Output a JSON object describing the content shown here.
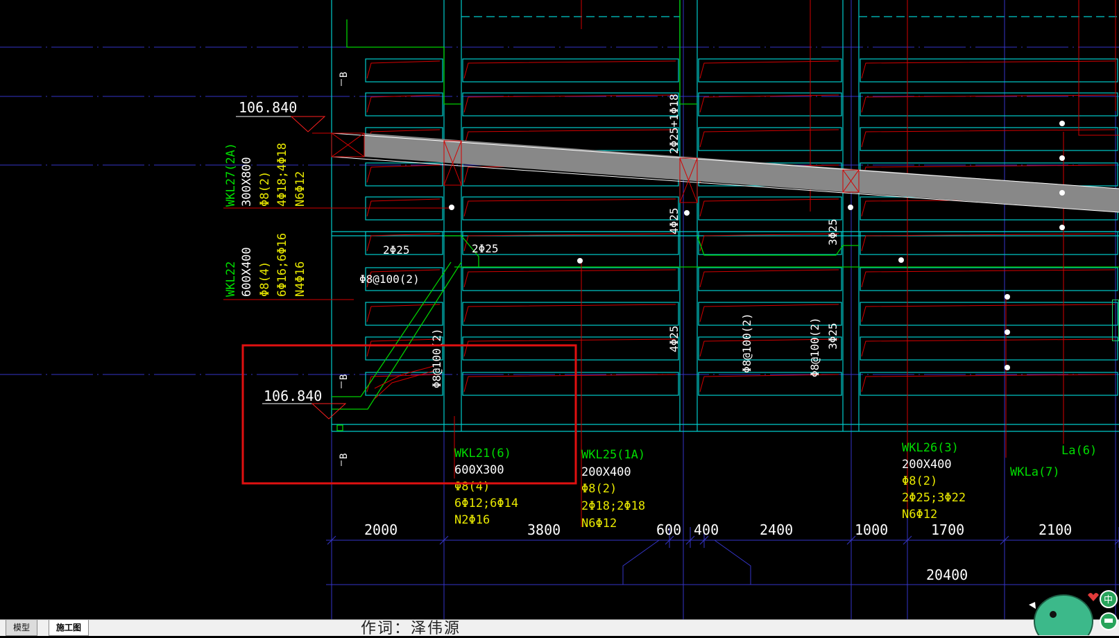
{
  "tabs": [
    {
      "label": "模型"
    },
    {
      "label": "施工图"
    }
  ],
  "author": "作词：泽伟源",
  "elevations": {
    "top": "106.840",
    "bottom": "106.840"
  },
  "section_marks": {
    "b1": "B",
    "b2": "B",
    "b3": "B"
  },
  "beam_labels": {
    "wkl27": {
      "name": "WKL27(2A)",
      "size": "300X800",
      "stirrup": "Φ8(2)",
      "rebar": "4Φ18;4Φ18",
      "waist": "N6Φ12"
    },
    "wkl22": {
      "name": "WKL22",
      "size": "600X400",
      "stirrup": "Φ8(4)",
      "rebar": "6Φ16;6Φ16",
      "waist": "N4Φ16"
    },
    "wkl21": {
      "name": "WKL21(6)",
      "size": "600X300",
      "stirrup": "Φ8(4)",
      "rebar": "6Φ12;6Φ14",
      "waist": "N2Φ16"
    },
    "wkl25": {
      "name": "WKL25(1A)",
      "size": "200X400",
      "stirrup": "Φ8(2)",
      "rebar": "2Φ18;2Φ18",
      "waist": "N6Φ12"
    },
    "wkl26": {
      "name": "WKL26(3)",
      "size": "200X400",
      "stirrup": "Φ8(2)",
      "rebar": "2Φ25;3Φ22",
      "waist": "N6Φ12"
    },
    "wkla": {
      "name": "WKLa(7)"
    },
    "la": {
      "name": "La(6)"
    }
  },
  "rebar_notes": {
    "n1": "2Φ25",
    "n2": "2Φ25",
    "n3": "Φ8@100(2)",
    "n4": "2Φ25+1Φ18",
    "n5": "4Φ25",
    "n6": "3Φ25",
    "n7": "Φ8@100(2)",
    "n8": "4Φ25",
    "n9": "Φ8@100(2)",
    "n10": "Φ8@100(2)",
    "n11": "3Φ25"
  },
  "dimensions": [
    "2000",
    "3800",
    "600",
    "400",
    "2400",
    "1000",
    "1700",
    "2100"
  ],
  "total_dimension": "20400",
  "colors": {
    "background": "#000000",
    "cyan": "#00d7d7",
    "green": "#00e000",
    "yellow": "#e8e800",
    "red": "#e00000",
    "white": "#ffffff",
    "blue": "#3a3ad0",
    "hatch": "#808080",
    "highlight": "#e00000"
  }
}
